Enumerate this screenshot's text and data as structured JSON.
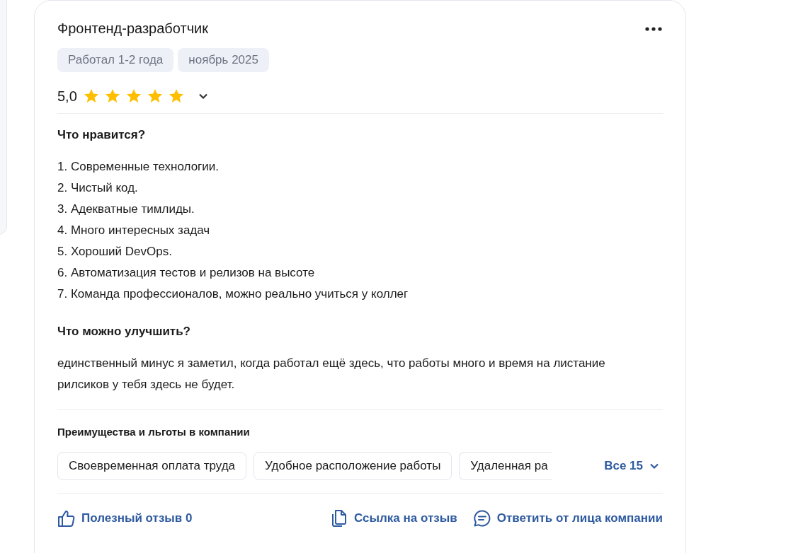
{
  "review": {
    "title": "Фронтенд-разработчик",
    "tags": [
      "Работал 1-2 года",
      "ноябрь 2025"
    ],
    "rating": "5,0",
    "stars": 5,
    "sections": [
      {
        "kind": "list",
        "heading": "Что нравится?",
        "lines": [
          "1. Современные технологии.",
          "2. Чистый код.",
          "3. Адекватные тимлиды.",
          "4. Много интересных задач",
          "5. Хороший DevOps.",
          "6. Автоматизация тестов и релизов на высоте",
          "7. Команда профессионалов, можно реально учиться у коллег"
        ]
      },
      {
        "kind": "text",
        "heading": "Что можно улучшить?",
        "text": "единственный минус я заметил, когда работал ещё здесь, что работы много и время на листание рилсиков у тебя здесь не будет."
      }
    ],
    "perks": {
      "heading": "Преимущества и льготы в компании",
      "items": [
        {
          "label": "Своевременная оплата труда",
          "cut": false
        },
        {
          "label": "Удобное расположение работы",
          "cut": false
        },
        {
          "label": "Удаленная ра",
          "cut": true
        }
      ],
      "more": "Все 15"
    },
    "actions": [
      {
        "kind": "like",
        "label": "Полезный отзыв 0"
      },
      {
        "kind": "copy",
        "label": "Ссылка на отзыв"
      },
      {
        "kind": "reply",
        "label": "Ответить от лица компании"
      }
    ]
  }
}
